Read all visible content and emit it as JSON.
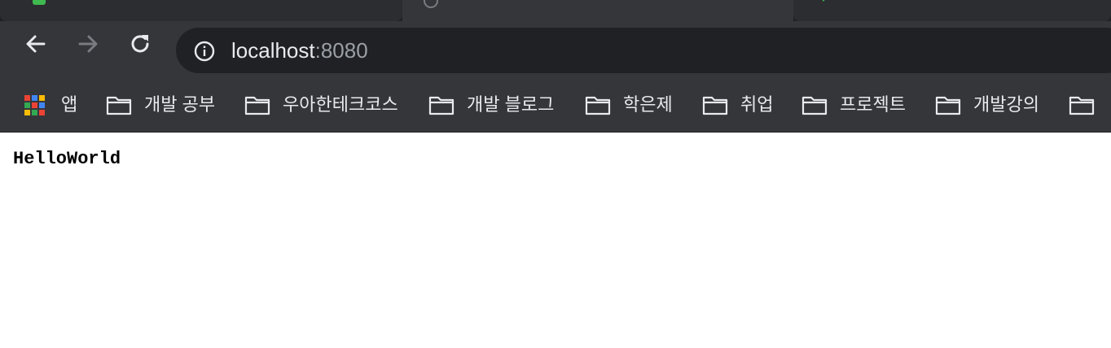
{
  "address_bar": {
    "host": "localhost",
    "port": ":8080"
  },
  "bookmarks": {
    "apps_label": "앱",
    "folders": [
      "개발 공부",
      "우아한테크코스",
      "개발 블로그",
      "학은제",
      "취업",
      "프로젝트",
      "개발강의"
    ]
  },
  "page": {
    "body_text": "HelloWorld"
  },
  "colors": {
    "toolbar_bg": "#35363a",
    "tabstrip_bg": "#1f2023",
    "omnibox_bg": "#202124",
    "text_primary": "#e8eaed",
    "text_secondary": "#9aa0a6",
    "favicon_green": "#3fb950"
  },
  "icons": {
    "back": "arrow-left-icon",
    "forward": "arrow-right-icon",
    "reload": "reload-icon",
    "site_info": "info-icon",
    "apps": "apps-grid-icon",
    "folder": "folder-icon"
  }
}
